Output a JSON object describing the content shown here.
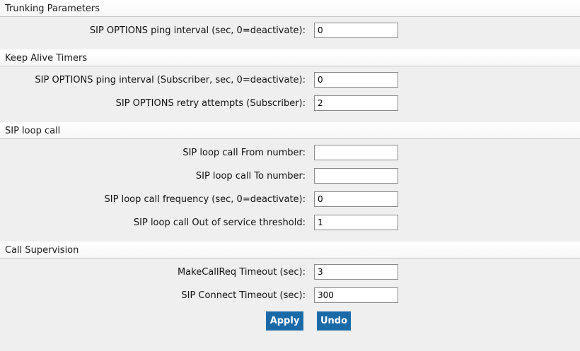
{
  "sections": [
    {
      "title": "Trunking Parameters",
      "fields": [
        {
          "label": "SIP OPTIONS ping interval (sec, 0=deactivate):",
          "value": "0"
        }
      ]
    },
    {
      "title": "Keep Alive Timers",
      "fields": [
        {
          "label": "SIP OPTIONS ping interval (Subscriber, sec, 0=deactivate):",
          "value": "0"
        },
        {
          "label": "SIP OPTIONS retry attempts (Subscriber):",
          "value": "2"
        }
      ]
    },
    {
      "title": "SIP loop call",
      "fields": [
        {
          "label": "SIP loop call From number:",
          "value": ""
        },
        {
          "label": "SIP loop call To number:",
          "value": ""
        },
        {
          "label": "SIP loop call frequency (sec, 0=deactivate):",
          "value": "0"
        },
        {
          "label": "SIP loop call Out of service threshold:",
          "value": "1"
        }
      ]
    },
    {
      "title": "Call Supervision",
      "fields": [
        {
          "label": "MakeCallReq Timeout (sec):",
          "value": "3"
        },
        {
          "label": "SIP Connect Timeout (sec):",
          "value": "300"
        }
      ]
    }
  ],
  "buttons": {
    "apply": "Apply",
    "undo": "Undo"
  },
  "colors": {
    "button_bg": "#1a6aa8",
    "page_bg": "#efefef"
  }
}
